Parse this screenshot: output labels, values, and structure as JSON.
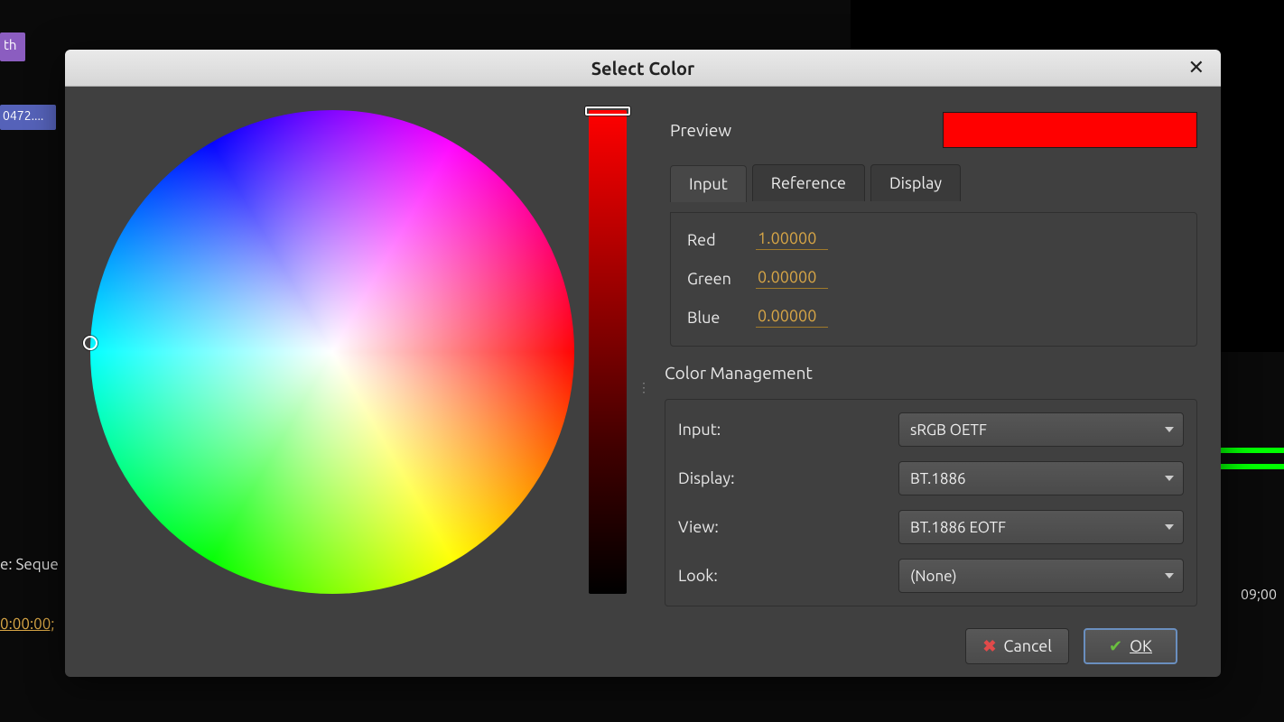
{
  "bg": {
    "clip_purple": "th",
    "clip_blue": "0472....",
    "seq_label": "e: Seque",
    "timecode": "0:00:00;",
    "right_timecode": "09;00"
  },
  "dialog": {
    "title": "Select Color"
  },
  "preview": {
    "label": "Preview",
    "color": "#ff0000"
  },
  "tabs": {
    "input": "Input",
    "reference": "Reference",
    "display": "Display"
  },
  "rgb": {
    "red_label": "Red",
    "red_value": "1.00000",
    "green_label": "Green",
    "green_value": "0.00000",
    "blue_label": "Blue",
    "blue_value": "0.00000"
  },
  "color_management": {
    "title": "Color Management",
    "input_label": "Input:",
    "input_value": "sRGB OETF",
    "display_label": "Display:",
    "display_value": "BT.1886",
    "view_label": "View:",
    "view_value": "BT.1886 EOTF",
    "look_label": "Look:",
    "look_value": "(None)"
  },
  "buttons": {
    "cancel": "Cancel",
    "ok": "OK"
  }
}
